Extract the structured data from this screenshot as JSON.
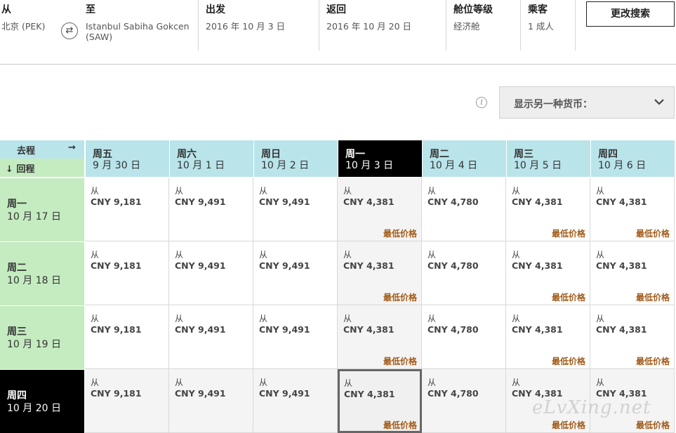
{
  "search": {
    "from": {
      "label": "从",
      "value": "北京 (PEK)"
    },
    "to": {
      "label": "至",
      "value_line1": "Istanbul Sabiha Gokcen",
      "value_line2": "(SAW)"
    },
    "depart": {
      "label": "出发",
      "value": "2016 年 10 月 3 日"
    },
    "return": {
      "label": "返回",
      "value": "2016 年 10 月 20 日"
    },
    "cabin": {
      "label": "舱位等级",
      "value": "经济舱"
    },
    "passengers": {
      "label": "乘客",
      "value": "1 成人"
    },
    "modify_label": "更改搜索"
  },
  "currency": {
    "label": "显示另一种货币："
  },
  "grid": {
    "outbound_label": "去程",
    "outbound_arrow": "→",
    "return_label": "↓ 回程",
    "from_text": "从",
    "lowest_text": "最低价格",
    "columns": [
      {
        "day": "周五",
        "date": "9 月 30 日"
      },
      {
        "day": "周六",
        "date": "10 月 1 日"
      },
      {
        "day": "周日",
        "date": "10 月 2 日"
      },
      {
        "day": "周一",
        "date": "10 月 3 日"
      },
      {
        "day": "周二",
        "date": "10 月 4 日"
      },
      {
        "day": "周三",
        "date": "10 月 5 日"
      },
      {
        "day": "周四",
        "date": "10 月 6 日"
      }
    ],
    "rows": [
      {
        "day": "周一",
        "date": "10 月 17 日"
      },
      {
        "day": "周二",
        "date": "10 月 18 日"
      },
      {
        "day": "周三",
        "date": "10 月 19 日"
      },
      {
        "day": "周四",
        "date": "10 月 20 日"
      }
    ],
    "prices": [
      "CNY 9,181",
      "CNY 9,491",
      "CNY 9,491",
      "CNY 4,381",
      "CNY 4,780",
      "CNY 4,381",
      "CNY 4,381"
    ],
    "lowest_columns": [
      3,
      5,
      6
    ],
    "selected_column": 3,
    "selected_row": 3
  },
  "watermark": "eLvXing.net",
  "colors": {
    "outbound_header": "#b9e4ea",
    "return_header": "#c5ebc0",
    "lowest_price": "#a15a18",
    "selected": "#000000"
  }
}
